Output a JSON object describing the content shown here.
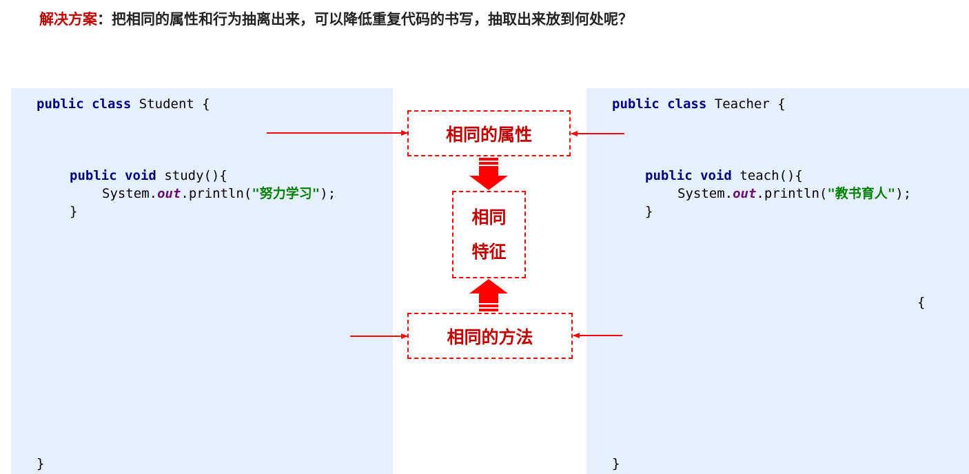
{
  "heading": {
    "label": "解决方案",
    "colon": "：",
    "text": "把相同的属性和行为抽离出来，可以降低重复代码的书写，抽取出来放到何处呢？"
  },
  "student_code": {
    "kw_public": "public",
    "kw_class": "class",
    "class_name": "Student",
    "open_brace": "{",
    "kw_void": "void",
    "method": "study(){",
    "system": "System.",
    "field": "out",
    "println": ".println(",
    "string": "\"努力学习\"",
    "close_stmt": ");",
    "close_method": "}",
    "close_class": "}"
  },
  "teacher_code": {
    "kw_public": "public",
    "kw_class": "class",
    "class_name": "Teacher",
    "open_brace": "{",
    "kw_void": "void",
    "method": "teach(){",
    "system": "System.",
    "field": "out",
    "println": ".println(",
    "string": "\"教书育人\"",
    "close_stmt": ");",
    "close_method": "}",
    "stray_brace": "{",
    "close_class": "}"
  },
  "labels": {
    "same_attributes": "相同的属性",
    "same_feature_1": "相同",
    "same_feature_2": "特征",
    "same_methods": "相同的方法"
  },
  "colors": {
    "accent_red": "#ff0000",
    "label_red": "#c00000",
    "panel_bg": "#e6effd",
    "keyword": "#000080",
    "string": "#008000",
    "field": "#660e7a"
  }
}
